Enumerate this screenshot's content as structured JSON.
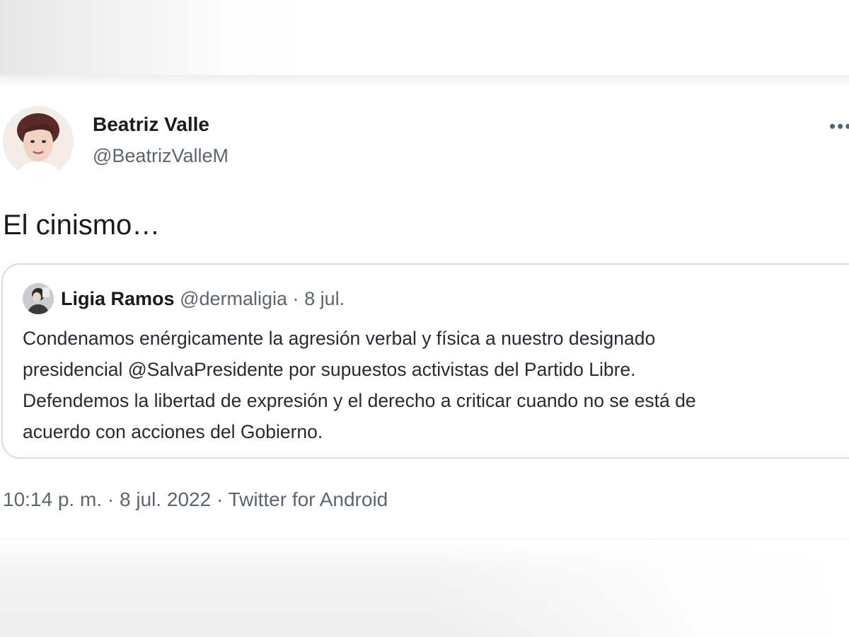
{
  "tweet": {
    "author_name": "Beatriz Valle",
    "author_handle": "@BeatrizValleM",
    "more_label": "•••",
    "text": "El cinismo…",
    "timestamp": "10:14 p. m.",
    "date": "8 jul. 2022",
    "separator": "·",
    "source": "Twitter for Android"
  },
  "quoted_tweet": {
    "author_name": "Ligia Ramos",
    "author_handle": "@dermaligia",
    "separator": "·",
    "date": "8 jul.",
    "lines": [
      "Condenamos enérgicamente la agresión verbal y física a nuestro designado",
      "presidencial @SalvaPresidente por supuestos activistas del Partido Libre.",
      "Defendemos la libertad de expresión y el derecho a criticar cuando no se está de",
      "acuerdo con acciones del Gobierno."
    ]
  },
  "colors": {
    "text_primary": "#1b1b1b",
    "text_secondary": "#5b6670",
    "card_border": "#d4dde3"
  },
  "icons": {
    "more": "more-horizontal-icon"
  }
}
